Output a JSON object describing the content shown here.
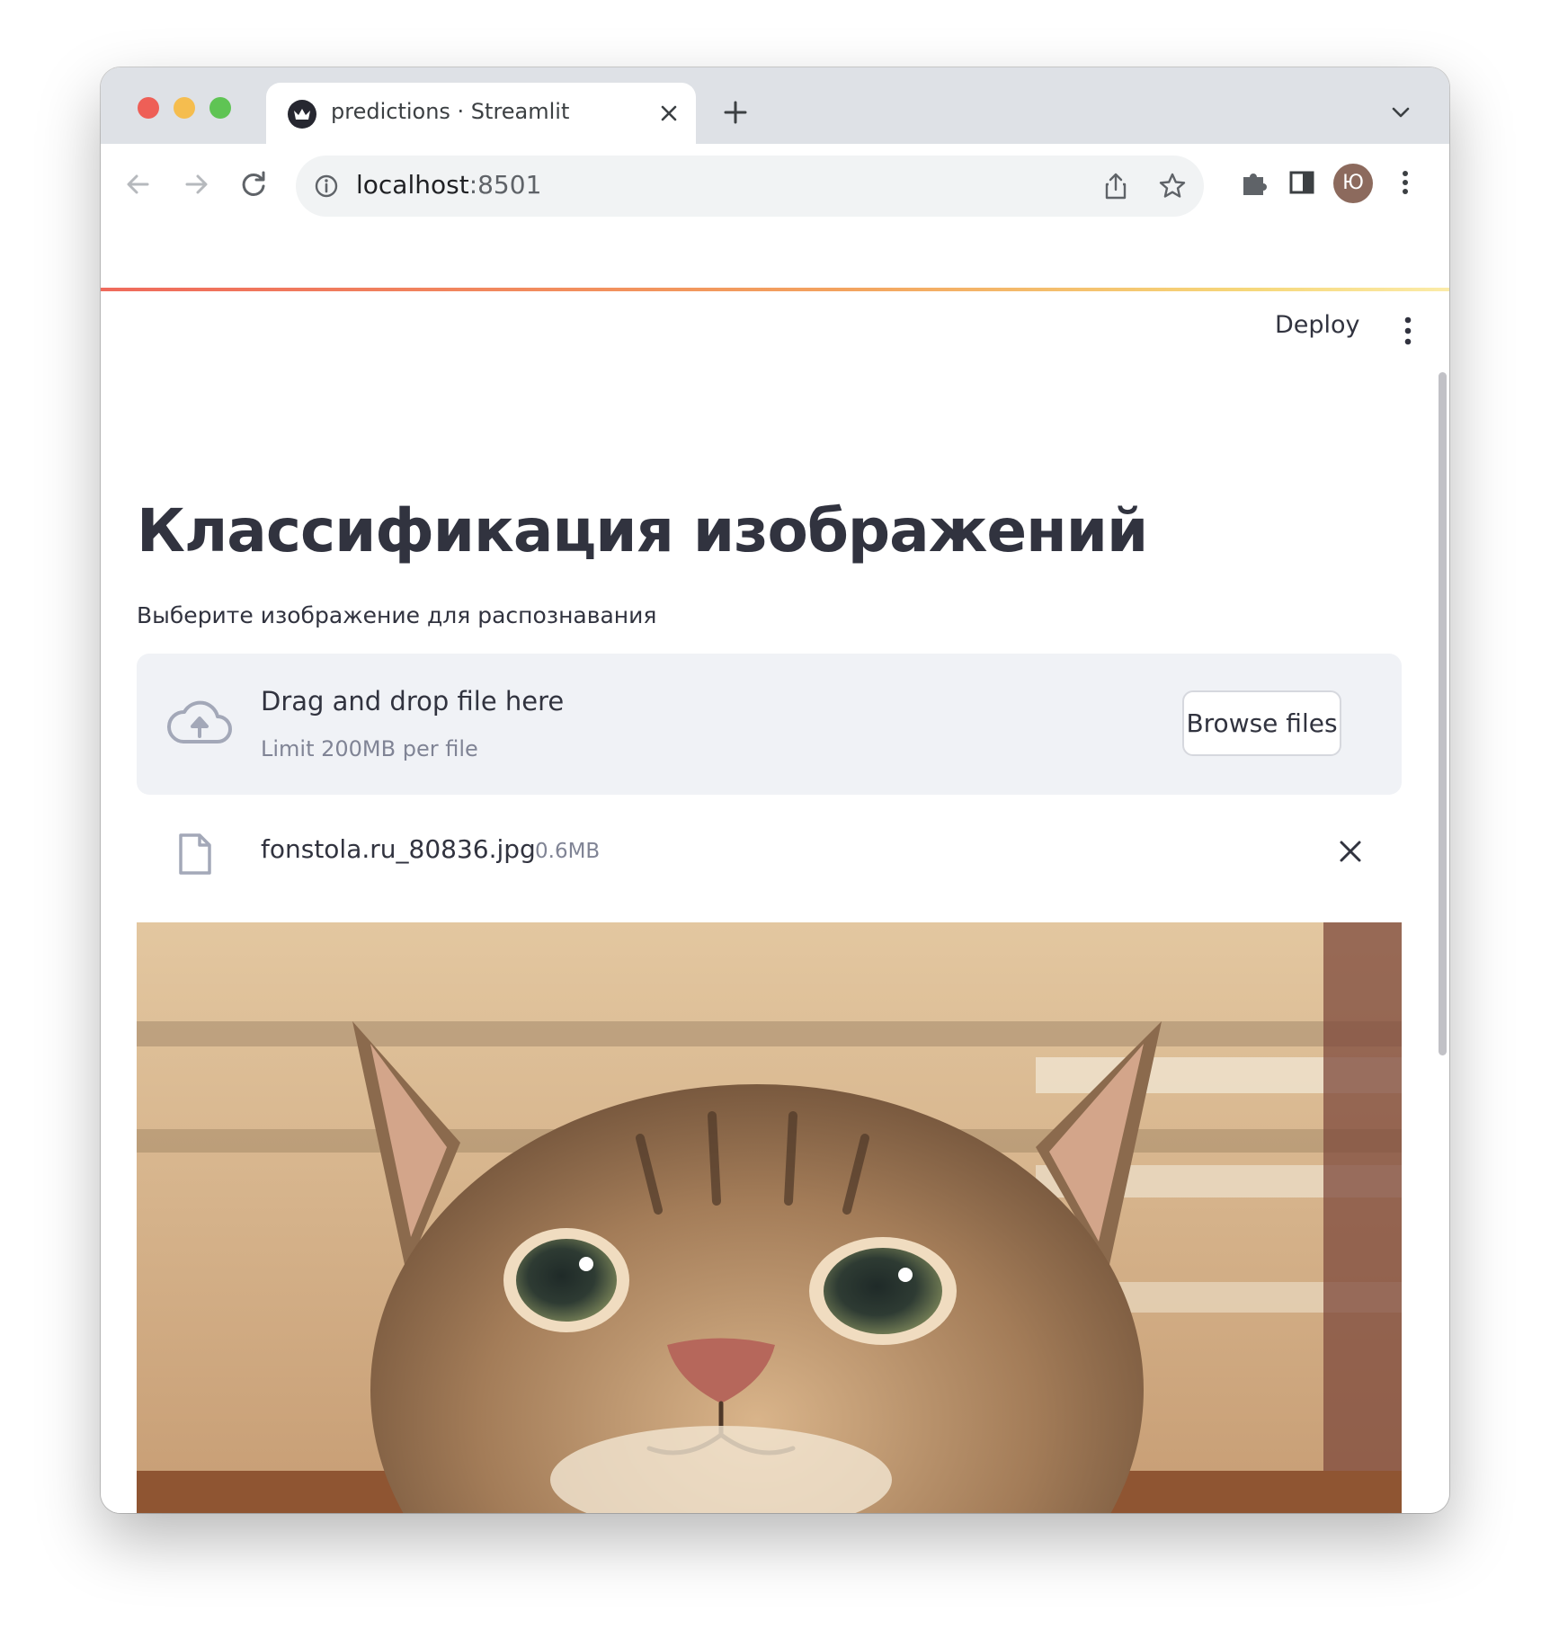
{
  "browser": {
    "tab": {
      "title": "predictions · Streamlit",
      "favicon_icon": "streamlit-crown-icon"
    },
    "address": {
      "host": "localhost",
      "port": ":8501"
    },
    "profile_initial": "Ю",
    "colors": {
      "tabstrip": "#dee1e6",
      "omnibox": "#f1f3f4",
      "avatar": "#8c6a5d"
    }
  },
  "streamlit": {
    "header": {
      "deploy_label": "Deploy"
    },
    "title": "Классификация изображений",
    "uploader": {
      "label": "Выберите изображение для распознавания",
      "drop_text": "Drag and drop file here",
      "limit_text": "Limit 200MB per file",
      "browse_label": "Browse files"
    },
    "uploaded_file": {
      "name": "fonstola.ru_80836.jpg",
      "size": "0.6MB"
    },
    "image": {
      "description_icon": "cat-photo"
    },
    "colors": {
      "text": "#31333f",
      "muted": "#808495",
      "dropzone_bg": "#f0f2f6",
      "icon": "#a3a8b8"
    }
  }
}
